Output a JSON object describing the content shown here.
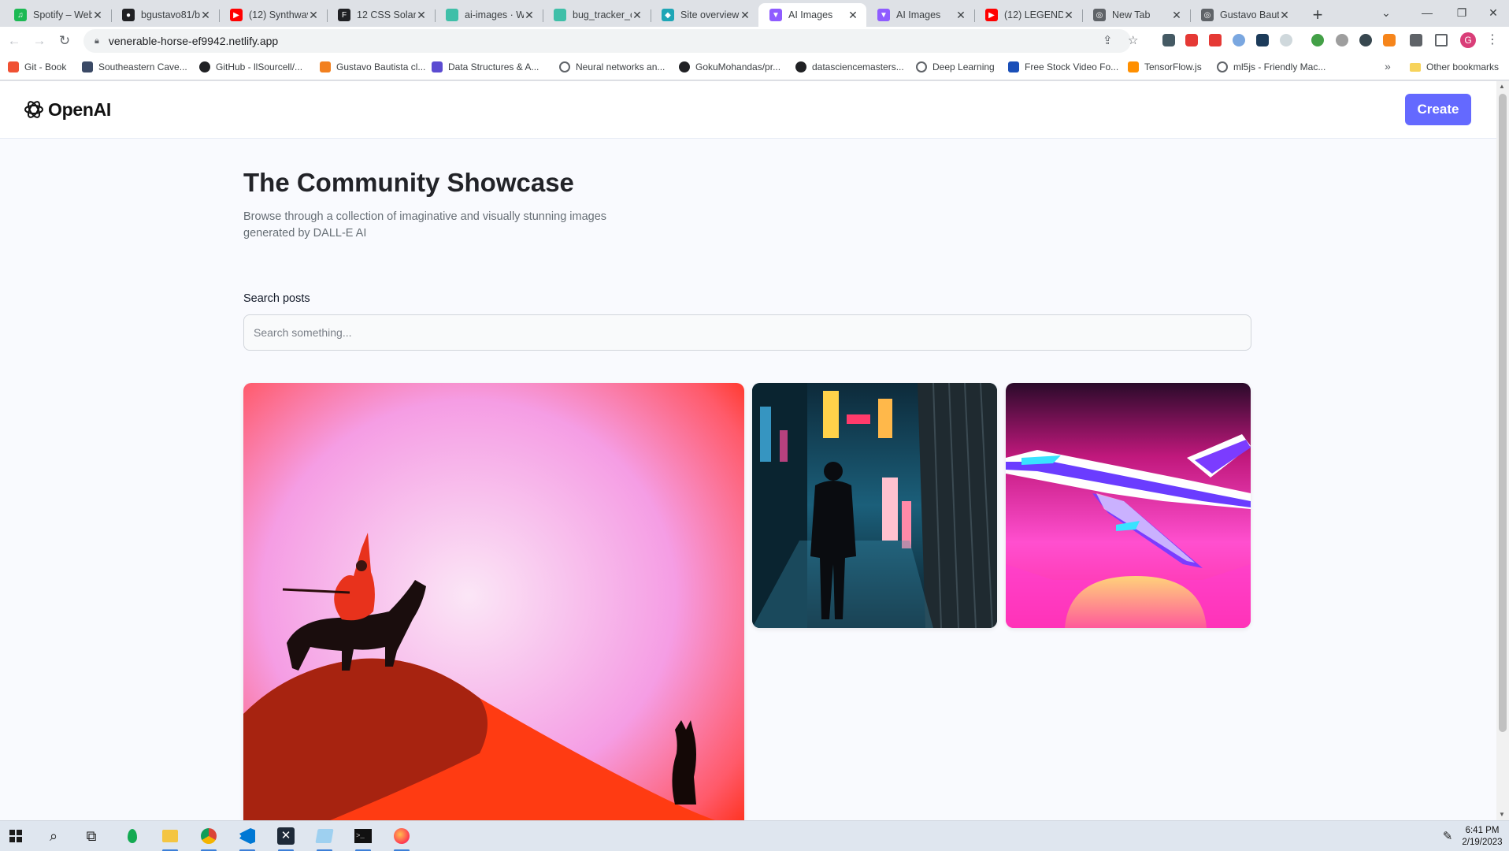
{
  "browser": {
    "tabs": [
      {
        "title": "Spotify – Web",
        "fav": "spotify-icon",
        "color": "#1db954",
        "glyph": "♫"
      },
      {
        "title": "bgustavo81/b",
        "fav": "github-icon",
        "color": "#202124",
        "glyph": "●"
      },
      {
        "title": "(12) Synthwav",
        "fav": "youtube-icon",
        "color": "#ff0000",
        "glyph": "▶"
      },
      {
        "title": "12 CSS Solar",
        "fav": "f-icon",
        "color": "#202124",
        "glyph": "F"
      },
      {
        "title": "ai-images · W",
        "fav": "page-icon",
        "color": "#3fbfa8",
        "glyph": ""
      },
      {
        "title": "bug_tracker_c",
        "fav": "page-icon",
        "color": "#3fbfa8",
        "glyph": ""
      },
      {
        "title": "Site overview",
        "fav": "netlify-icon",
        "color": "#1ea6b6",
        "glyph": "◆"
      },
      {
        "title": "AI Images",
        "fav": "vite-icon",
        "color": "#8f5cff",
        "glyph": "▼",
        "active": true
      },
      {
        "title": "AI Images",
        "fav": "vite-icon",
        "color": "#8f5cff",
        "glyph": "▼"
      },
      {
        "title": "(12) LEGENDS",
        "fav": "youtube-icon",
        "color": "#ff0000",
        "glyph": "▶"
      },
      {
        "title": "New Tab",
        "fav": "chrome-icon",
        "color": "#5f6368",
        "glyph": "◎"
      },
      {
        "title": "Gustavo Baut",
        "fav": "globe-icon",
        "color": "#5f6368",
        "glyph": "◎"
      }
    ],
    "url": "venerable-horse-ef9942.netlify.app",
    "profile_initial": "G",
    "bookmarks": [
      {
        "label": "Git - Book",
        "icon": "git-icon",
        "color": "#f05133"
      },
      {
        "label": "Southeastern Cave...",
        "icon": "image-icon",
        "color": "#3b4a66"
      },
      {
        "label": "GitHub - llSourcell/...",
        "icon": "github-icon",
        "color": "#202124"
      },
      {
        "label": "Gustavo Bautista cl...",
        "icon": "cube-icon",
        "color": "#f2801f"
      },
      {
        "label": "Data Structures & A...",
        "icon": "u-icon",
        "color": "#5b4bd1"
      },
      {
        "label": "Neural networks an...",
        "icon": "globe-icon",
        "color": "#5f6368"
      },
      {
        "label": "GokuMohandas/pr...",
        "icon": "github-icon",
        "color": "#202124"
      },
      {
        "label": "datasciencemasters...",
        "icon": "github-icon",
        "color": "#202124"
      },
      {
        "label": "Deep Learning",
        "icon": "globe-icon",
        "color": "#5f6368"
      },
      {
        "label": "Free Stock Video Fo...",
        "icon": "v-icon",
        "color": "#1a4fb8"
      },
      {
        "label": "TensorFlow.js",
        "icon": "tensorflow-icon",
        "color": "#ff8f00"
      },
      {
        "label": "ml5js - Friendly Mac...",
        "icon": "globe-icon",
        "color": "#5f6368"
      }
    ],
    "bookmarks_more": "»",
    "other_bookmarks": "Other bookmarks"
  },
  "site": {
    "logo_text": "OpenAI",
    "create_label": "Create",
    "title": "The Community Showcase",
    "description": "Browse through a collection of imaginative and visually stunning images generated by DALL-E AI",
    "search_label": "Search posts",
    "search_placeholder": "Search something...",
    "search_value": "",
    "accent": "#6469ff"
  },
  "cards": [
    {
      "subject": "witch-on-horse-red-sunset"
    },
    {
      "subject": "man-in-neon-city-street"
    },
    {
      "subject": "synthwave-jet-plane"
    }
  ],
  "taskbar": {
    "time": "6:41 PM",
    "date": "2/19/2023"
  }
}
